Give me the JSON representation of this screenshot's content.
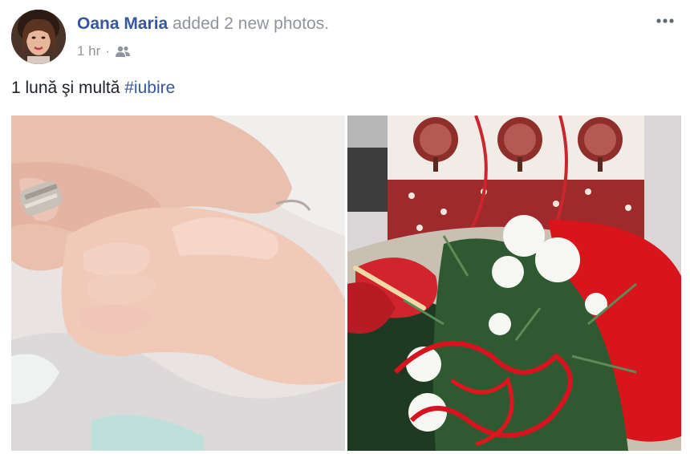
{
  "post": {
    "author": "Oana Maria",
    "action": "added 2 new photos.",
    "timestamp": "1 hr",
    "separator": "·",
    "audience_icon": "friends-icon",
    "more_icon": "more-options-icon",
    "text": "1 lună şi multă ",
    "hashtag": "#iubire"
  },
  "photos": [
    {
      "icon": "photo-baby-hand"
    },
    {
      "icon": "photo-flowers-gift"
    }
  ],
  "colors": {
    "link": "#365899",
    "meta": "#90949c",
    "text": "#1d2129"
  }
}
